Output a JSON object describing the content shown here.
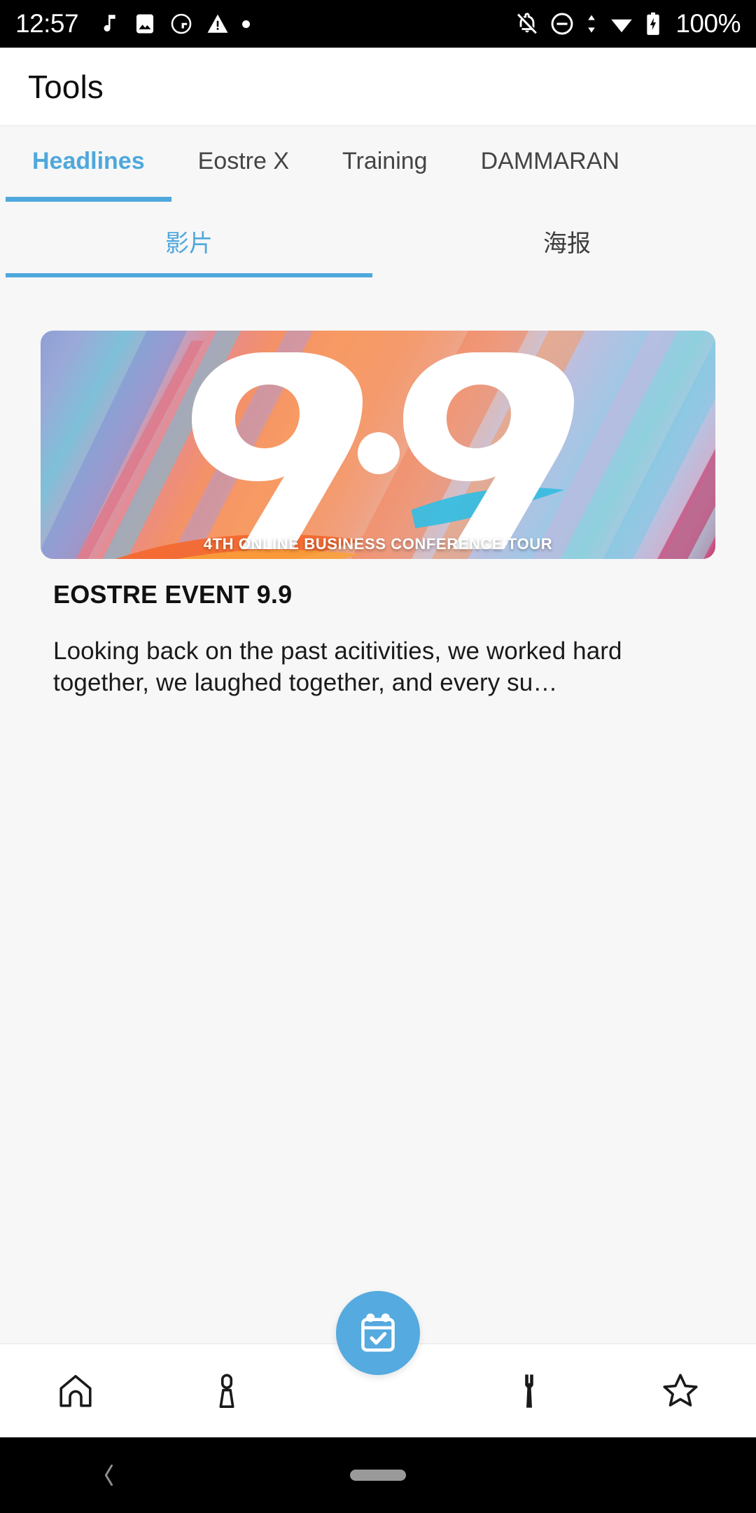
{
  "status_bar": {
    "time": "12:57",
    "battery_text": "100%",
    "left_icons": [
      "music-note-icon",
      "image-icon",
      "g-circle-icon",
      "warning-triangle-icon",
      "dot-icon"
    ],
    "right_icons": [
      "bell-off-icon",
      "do-not-disturb-icon",
      "data-transfer-icon",
      "wifi-icon",
      "battery-charging-icon"
    ],
    "background": "#000000",
    "foreground": "#ffffff"
  },
  "app_bar": {
    "title": "Tools"
  },
  "accent_color": "#4FA8DC",
  "tabs_primary": {
    "items": [
      {
        "label": "Headlines",
        "active": true
      },
      {
        "label": "Eostre X",
        "active": false
      },
      {
        "label": "Training",
        "active": false
      },
      {
        "label": "DAMMARAN",
        "active": false
      }
    ]
  },
  "tabs_secondary": {
    "items": [
      {
        "label": "影片",
        "active": true
      },
      {
        "label": "海报",
        "active": false
      }
    ]
  },
  "article": {
    "hero_number_left": "9",
    "hero_number_right": "9",
    "hero_caption": "4TH ONLINE BUSINESS CONFERENCE TOUR",
    "title": "EOSTRE EVENT 9.9",
    "description": "Looking back on the past acitivities, we worked hard together, we laughed together, and every su…"
  },
  "bottom_nav": {
    "items": [
      {
        "icon": "home-icon",
        "active": false
      },
      {
        "icon": "person-icon",
        "active": false
      },
      {
        "icon": "calendar-check-icon",
        "active": true,
        "is_fab": true
      },
      {
        "icon": "wrench-icon",
        "active": true
      },
      {
        "icon": "star-icon",
        "active": false
      }
    ],
    "fab_color": "#55AADF"
  },
  "android_nav": {
    "back_icon": "back-chevron-icon",
    "home_pill": "home-pill-handle"
  }
}
